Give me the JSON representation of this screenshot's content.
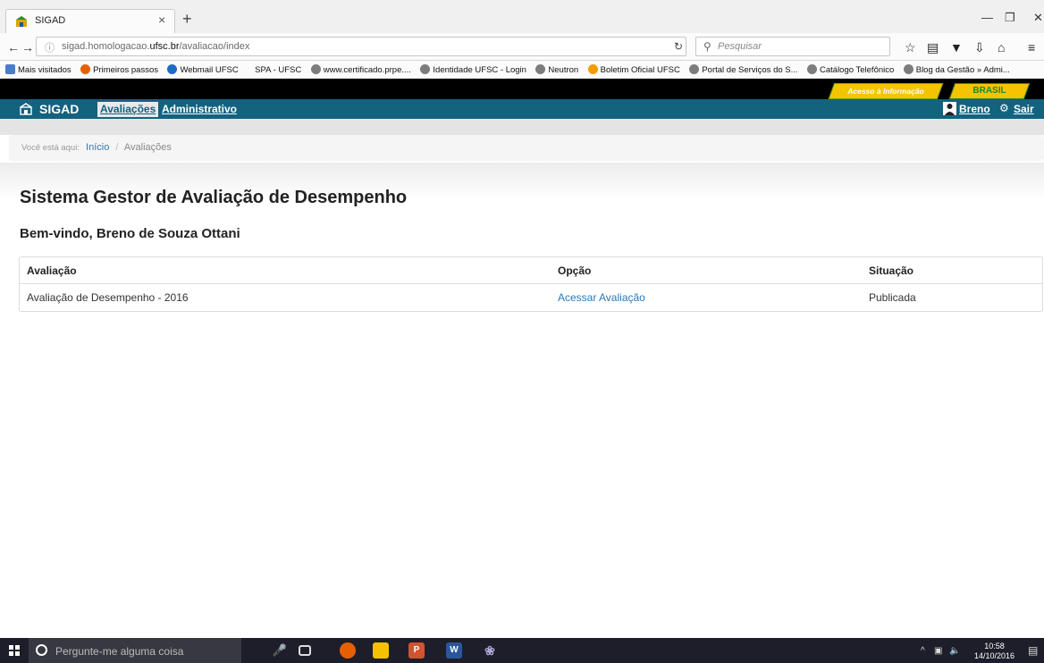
{
  "browser": {
    "tab_title": "SIGAD",
    "tab_close": "×",
    "new_tab": "+",
    "url_prefix": "sigad.homologacao.",
    "url_domain": "ufsc.br",
    "url_path": "/avaliacao/index",
    "search_placeholder": "Pesquisar",
    "bookmarks": [
      "Mais visitados",
      "Primeiros passos",
      "Webmail UFSC",
      "SPA - UFSC",
      "www.certificado.prpe....",
      "Identidade UFSC - Login",
      "Neutron",
      "Boletim Oficial UFSC",
      "Portal de Serviços do S...",
      "Catálogo Telefônico",
      "Blog da Gestão » Admi..."
    ]
  },
  "gov": {
    "acesso": "Acesso à Informação",
    "brasil": "BRASIL"
  },
  "app": {
    "brand": "SIGAD",
    "menu": [
      "Avaliações",
      "Administrativo"
    ],
    "user": "Breno",
    "logout": "Sair"
  },
  "breadcrumb": {
    "label": "Você está aqui:",
    "home": "Início",
    "separator": "/",
    "current": "Avaliações"
  },
  "page": {
    "title": "Sistema Gestor de Avaliação de Desempenho",
    "welcome": "Bem-vindo, Breno de Souza Ottani"
  },
  "table": {
    "headers": [
      "Avaliação",
      "Opção",
      "Situação"
    ],
    "rows": [
      {
        "avaliacao": "Avaliação de Desempenho - 2016",
        "opcao": "Acessar Avaliação",
        "situacao": "Publicada"
      }
    ]
  },
  "taskbar": {
    "search_placeholder": "Pergunte-me alguma coisa",
    "time": "10:58",
    "date": "14/10/2016"
  },
  "colors": {
    "app_bar": "#13627e",
    "link": "#2a7ab8",
    "gov_yellow": "#f5c400"
  }
}
